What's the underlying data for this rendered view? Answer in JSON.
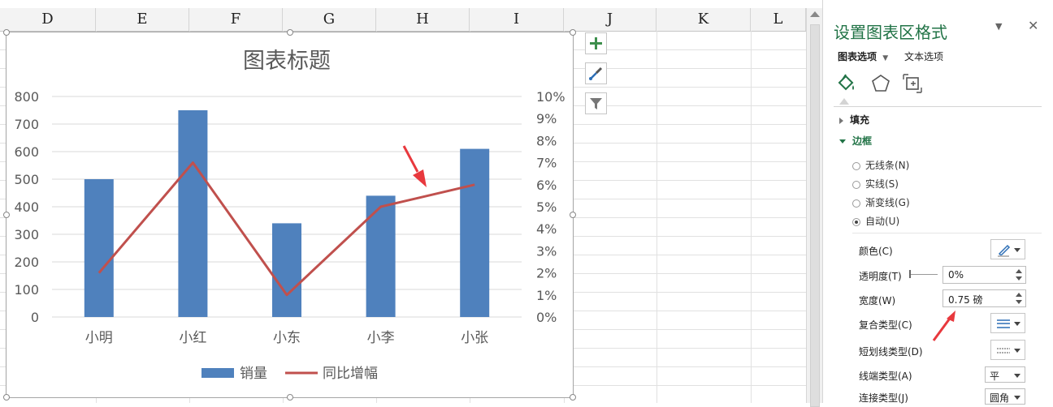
{
  "sheet": {
    "columns": [
      "D",
      "E",
      "F",
      "G",
      "H",
      "I",
      "J",
      "K",
      "L"
    ]
  },
  "chart": {
    "side_buttons": [
      "plus-icon",
      "brush-icon",
      "filter-icon"
    ]
  },
  "chart_data": {
    "type": "bar",
    "title": "图表标题",
    "categories": [
      "小明",
      "小红",
      "小东",
      "小李",
      "小张"
    ],
    "series": [
      {
        "name": "销量",
        "type": "bar",
        "color": "#4f81bd",
        "values": [
          500,
          750,
          340,
          440,
          610
        ]
      },
      {
        "name": "同比增幅",
        "type": "line",
        "color": "#c0504d",
        "axis": "secondary",
        "values": [
          0.02,
          0.07,
          0.01,
          0.05,
          0.06
        ]
      }
    ],
    "y_ticks": [
      "800",
      "700",
      "600",
      "500",
      "400",
      "300",
      "200",
      "100",
      "0"
    ],
    "y2_ticks": [
      "10%",
      "9%",
      "8%",
      "7%",
      "6%",
      "5%",
      "4%",
      "3%",
      "2%",
      "1%",
      "0%"
    ],
    "ylim": [
      0,
      800
    ],
    "y2lim": [
      0,
      0.1
    ],
    "grid": true,
    "legend": "bottom",
    "annotation_color": "#e8383d"
  },
  "panel": {
    "title": "设置图表区格式",
    "tabs": [
      "图表选项",
      "文本选项"
    ],
    "icons": [
      "fill-line-icon",
      "effects-icon",
      "size-properties-icon"
    ],
    "sections": {
      "fill": "填充",
      "border": "边框"
    },
    "radios": [
      {
        "label": "无线条(N)",
        "checked": false
      },
      {
        "label": "实线(S)",
        "checked": false
      },
      {
        "label": "渐变线(G)",
        "checked": false
      },
      {
        "label": "自动(U)",
        "checked": true
      }
    ],
    "props": {
      "color_label": "颜色(C)",
      "transparency_label": "透明度(T)",
      "transparency_value": "0%",
      "width_label": "宽度(W)",
      "width_value": "0.75 磅",
      "compound_label": "复合类型(C)",
      "dash_label": "短划线类型(D)",
      "cap_label": "线端类型(A)",
      "cap_value": "平",
      "join_label": "连接类型(J)",
      "join_value": "圆角"
    }
  }
}
